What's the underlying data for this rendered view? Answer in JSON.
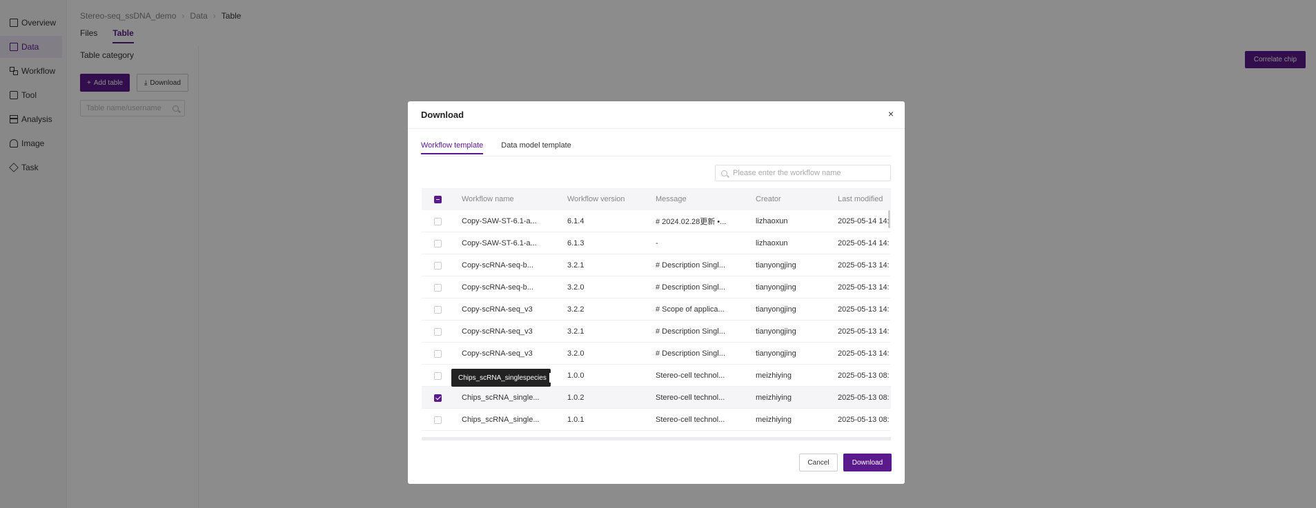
{
  "sidebar": {
    "items": [
      {
        "label": "Overview",
        "icon": "document-icon"
      },
      {
        "label": "Data",
        "icon": "file-icon",
        "active": true
      },
      {
        "label": "Workflow",
        "icon": "workflow-icon"
      },
      {
        "label": "Tool",
        "icon": "tool-icon"
      },
      {
        "label": "Analysis",
        "icon": "analysis-icon"
      },
      {
        "label": "Image",
        "icon": "image-icon"
      },
      {
        "label": "Task",
        "icon": "layers-icon"
      }
    ]
  },
  "breadcrumb": [
    "Stereo-seq_ssDNA_demo",
    "Data",
    "Table"
  ],
  "page_tabs": [
    {
      "label": "Files"
    },
    {
      "label": "Table",
      "active": true
    }
  ],
  "left_panel": {
    "title": "Table category",
    "add_table": "Add table",
    "download": "Download",
    "search_placeholder": "Table name/username"
  },
  "correlate_chip": "Correlate chip",
  "modal": {
    "title": "Download",
    "close": "×",
    "tabs": [
      {
        "label": "Workflow template",
        "active": true
      },
      {
        "label": "Data model template"
      }
    ],
    "search_placeholder": "Please enter the workflow name",
    "columns": [
      "Workflow name",
      "Workflow version",
      "Message",
      "Creator",
      "Last modified"
    ],
    "rows": [
      {
        "name": "Copy-SAW-ST-6.1-a...",
        "version": "6.1.4",
        "message": "# 2024.02.28更新 •...",
        "creator": "lizhaoxun",
        "modified": "2025-05-14 14:",
        "checked": false
      },
      {
        "name": "Copy-SAW-ST-6.1-a...",
        "version": "6.1.3",
        "message": "-",
        "creator": "lizhaoxun",
        "modified": "2025-05-14 14:",
        "checked": false
      },
      {
        "name": "Copy-scRNA-seq-b...",
        "version": "3.2.1",
        "message": "# Description Singl...",
        "creator": "tianyongjing",
        "modified": "2025-05-13 14:",
        "checked": false
      },
      {
        "name": "Copy-scRNA-seq-b...",
        "version": "3.2.0",
        "message": "# Description Singl...",
        "creator": "tianyongjing",
        "modified": "2025-05-13 14:",
        "checked": false
      },
      {
        "name": "Copy-scRNA-seq_v3",
        "version": "3.2.2",
        "message": "# Scope of applica...",
        "creator": "tianyongjing",
        "modified": "2025-05-13 14:",
        "checked": false
      },
      {
        "name": "Copy-scRNA-seq_v3",
        "version": "3.2.1",
        "message": "# Description Singl...",
        "creator": "tianyongjing",
        "modified": "2025-05-13 14:",
        "checked": false
      },
      {
        "name": "Copy-scRNA-seq_v3",
        "version": "3.2.0",
        "message": "# Description Singl...",
        "creator": "tianyongjing",
        "modified": "2025-05-13 14:",
        "checked": false
      },
      {
        "name": "",
        "version": "1.0.0",
        "message": "Stereo-cell technol...",
        "creator": "meizhiying",
        "modified": "2025-05-13 08:",
        "checked": false
      },
      {
        "name": "Chips_scRNA_single...",
        "version": "1.0.2",
        "message": "Stereo-cell technol...",
        "creator": "meizhiying",
        "modified": "2025-05-13 08:",
        "checked": true
      },
      {
        "name": "Chips_scRNA_single...",
        "version": "1.0.1",
        "message": "Stereo-cell technol...",
        "creator": "meizhiying",
        "modified": "2025-05-13 08:",
        "checked": false
      }
    ],
    "tooltip": "Chips_scRNA_singlespecies",
    "cancel": "Cancel",
    "download": "Download"
  },
  "colors": {
    "accent": "#5b1a8c",
    "overlay": "rgba(0,0,0,0.45)"
  }
}
